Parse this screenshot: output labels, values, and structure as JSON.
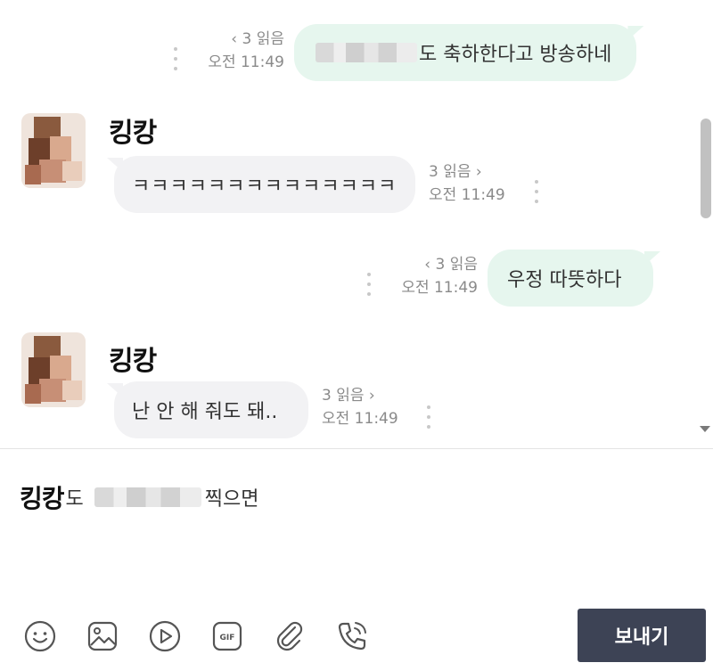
{
  "messages": [
    {
      "side": "sent",
      "read": "3 읽음",
      "time": "오전 11:49",
      "text": "도 축하한다고 방송하네"
    },
    {
      "side": "recv",
      "sender": "킹캉",
      "read": "3 읽음",
      "time": "오전 11:49",
      "text": "ㅋㅋㅋㅋㅋㅋㅋㅋㅋㅋㅋㅋㅋㅋ"
    },
    {
      "side": "sent",
      "read": "3 읽음",
      "time": "오전 11:49",
      "text": "우정 따뜻하다"
    },
    {
      "side": "recv",
      "sender": "킹캉",
      "read": "3 읽음",
      "time": "오전 11:49",
      "text": "난 안 해 줘도 돼.."
    }
  ],
  "chevrons": {
    "left": "‹",
    "right": "›"
  },
  "composer": {
    "mention": "킹캉",
    "particle": "도",
    "suffix": "찍으면"
  },
  "toolbar": {
    "icons": [
      "smiley-icon",
      "image-icon",
      "video-icon",
      "gif-icon",
      "attachment-icon",
      "call-icon"
    ],
    "gif_label": "GIF"
  },
  "send_button": {
    "label": "보내기"
  },
  "colors": {
    "sent_bubble": "#e6f6ee",
    "recv_bubble": "#f2f2f4",
    "send_button": "#3d4355",
    "meta_text": "#8a8a8a"
  }
}
